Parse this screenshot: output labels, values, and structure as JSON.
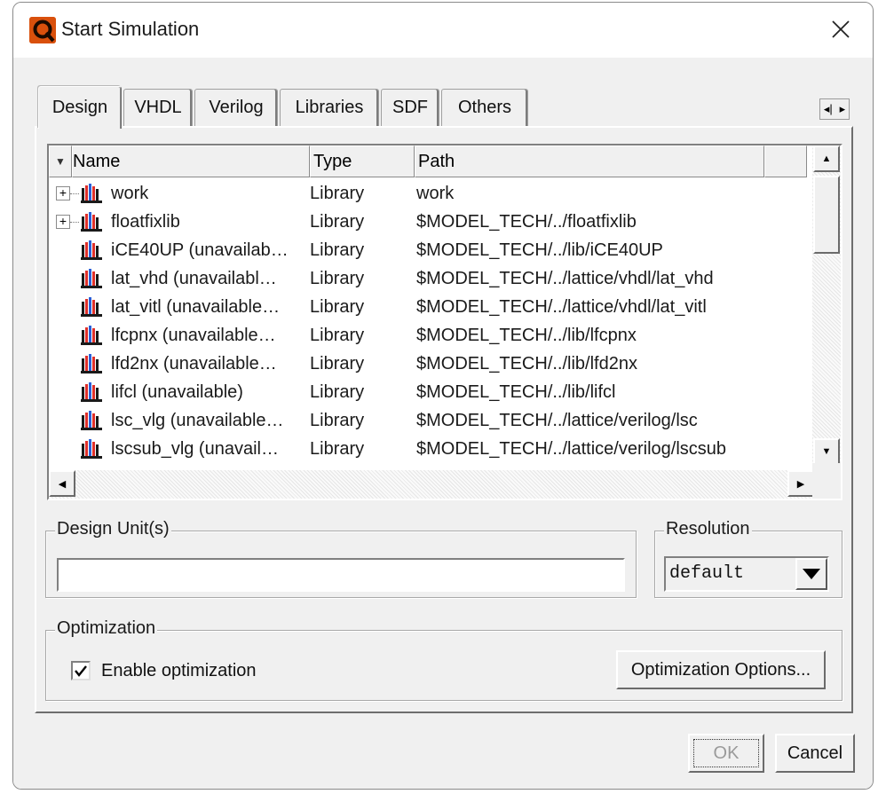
{
  "window": {
    "title": "Start Simulation",
    "icon": "modelsim-q-logo-icon"
  },
  "tabs": [
    {
      "label": "Design",
      "active": true
    },
    {
      "label": "VHDL",
      "active": false
    },
    {
      "label": "Verilog",
      "active": false
    },
    {
      "label": "Libraries",
      "active": false
    },
    {
      "label": "SDF",
      "active": false
    },
    {
      "label": "Others",
      "active": false
    }
  ],
  "library_list": {
    "columns": [
      "Name",
      "Type",
      "Path"
    ],
    "rows": [
      {
        "name": "work",
        "type": "Library",
        "path": "work",
        "expandable": true
      },
      {
        "name": "floatfixlib",
        "type": "Library",
        "path": "$MODEL_TECH/../floatfixlib",
        "expandable": true
      },
      {
        "name": "iCE40UP  (unavailab…",
        "type": "Library",
        "path": "$MODEL_TECH/../lib/iCE40UP",
        "expandable": false
      },
      {
        "name": "lat_vhd  (unavailabl…",
        "type": "Library",
        "path": "$MODEL_TECH/../lattice/vhdl/lat_vhd",
        "expandable": false
      },
      {
        "name": "lat_vitl  (unavailable…",
        "type": "Library",
        "path": "$MODEL_TECH/../lattice/vhdl/lat_vitl",
        "expandable": false
      },
      {
        "name": "lfcpnx  (unavailable…",
        "type": "Library",
        "path": "$MODEL_TECH/../lib/lfcpnx",
        "expandable": false
      },
      {
        "name": "lfd2nx  (unavailable…",
        "type": "Library",
        "path": "$MODEL_TECH/../lib/lfd2nx",
        "expandable": false
      },
      {
        "name": "lifcl  (unavailable)",
        "type": "Library",
        "path": "$MODEL_TECH/../lib/lifcl",
        "expandable": false
      },
      {
        "name": "lsc_vlg  (unavailable…",
        "type": "Library",
        "path": "$MODEL_TECH/../lattice/verilog/lsc",
        "expandable": false
      },
      {
        "name": "lscsub_vlg  (unavail…",
        "type": "Library",
        "path": "$MODEL_TECH/../lattice/verilog/lscsub",
        "expandable": false
      }
    ]
  },
  "design_units": {
    "label": "Design Unit(s)",
    "value": ""
  },
  "resolution": {
    "label": "Resolution",
    "value": "default"
  },
  "optimization": {
    "label": "Optimization",
    "enable_label": "Enable optimization",
    "enabled": true,
    "options_button": "Optimization Options..."
  },
  "buttons": {
    "ok": "OK",
    "cancel": "Cancel"
  },
  "colors": {
    "accent_icon": "#e35a10",
    "dialog_bg": "#f0f0f0"
  }
}
